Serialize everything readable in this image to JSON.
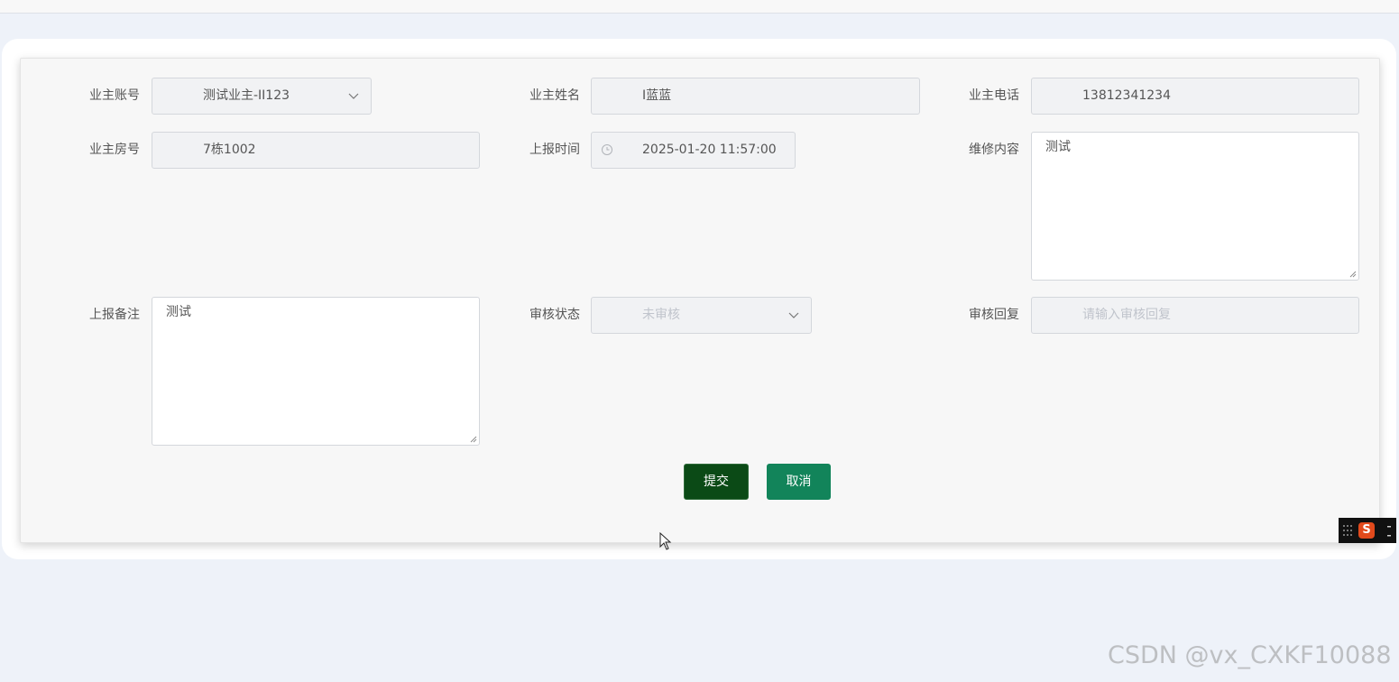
{
  "form": {
    "owner_account": {
      "label": "业主账号",
      "value": "测试业主-II123"
    },
    "owner_name": {
      "label": "业主姓名",
      "value": "I蓝蓝"
    },
    "owner_phone": {
      "label": "业主电话",
      "value": "13812341234"
    },
    "room_number": {
      "label": "业主房号",
      "value": "7栋1002"
    },
    "report_time": {
      "label": "上报时间",
      "value": "2025-01-20 11:57:00"
    },
    "repair_content": {
      "label": "维修内容",
      "value": "测试"
    },
    "report_remark": {
      "label": "上报备注",
      "value": "测试"
    },
    "review_status": {
      "label": "审核状态",
      "value": "未审核"
    },
    "review_reply": {
      "label": "审核回复",
      "placeholder": "请输入审核回复"
    }
  },
  "buttons": {
    "submit": "提交",
    "cancel": "取消"
  },
  "icons": {
    "dropdown": "chevron-down-icon",
    "time": "clock-icon",
    "ime": "sogou-ime-icon"
  },
  "watermark": "CSDN @vx_CXKF10088",
  "colors": {
    "submit_button": "#0b4a16",
    "cancel_button": "#12845a",
    "page_background": "#eef2f9"
  }
}
